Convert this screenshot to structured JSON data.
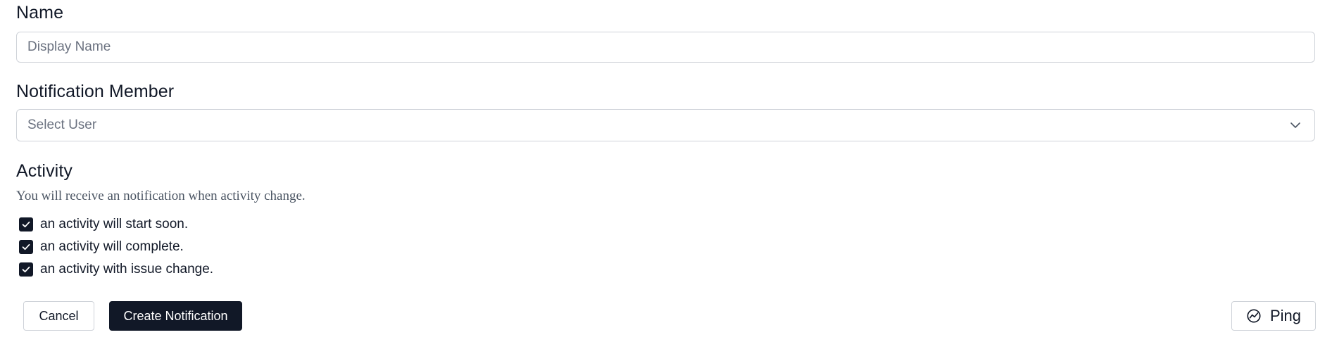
{
  "form": {
    "name": {
      "label": "Name",
      "placeholder": "Display Name",
      "value": ""
    },
    "member": {
      "label": "Notification Member",
      "placeholder": "Select User"
    },
    "activity": {
      "label": "Activity",
      "helper": "You will receive an notification when activity change.",
      "options": [
        {
          "label": "an activity will start soon.",
          "checked": true
        },
        {
          "label": "an activity will complete.",
          "checked": true
        },
        {
          "label": "an activity with issue change.",
          "checked": true
        }
      ]
    }
  },
  "actions": {
    "cancel_label": "Cancel",
    "create_label": "Create Notification",
    "ping_label": "Ping"
  },
  "icons": {
    "select_chevron": "chevron-down-icon",
    "checkbox_mark": "check-icon",
    "ping": "ping-icon"
  },
  "colors": {
    "primary": "#111827",
    "border": "#cfd3d9",
    "placeholder": "#6b7280",
    "helper_text": "#4b5563"
  }
}
